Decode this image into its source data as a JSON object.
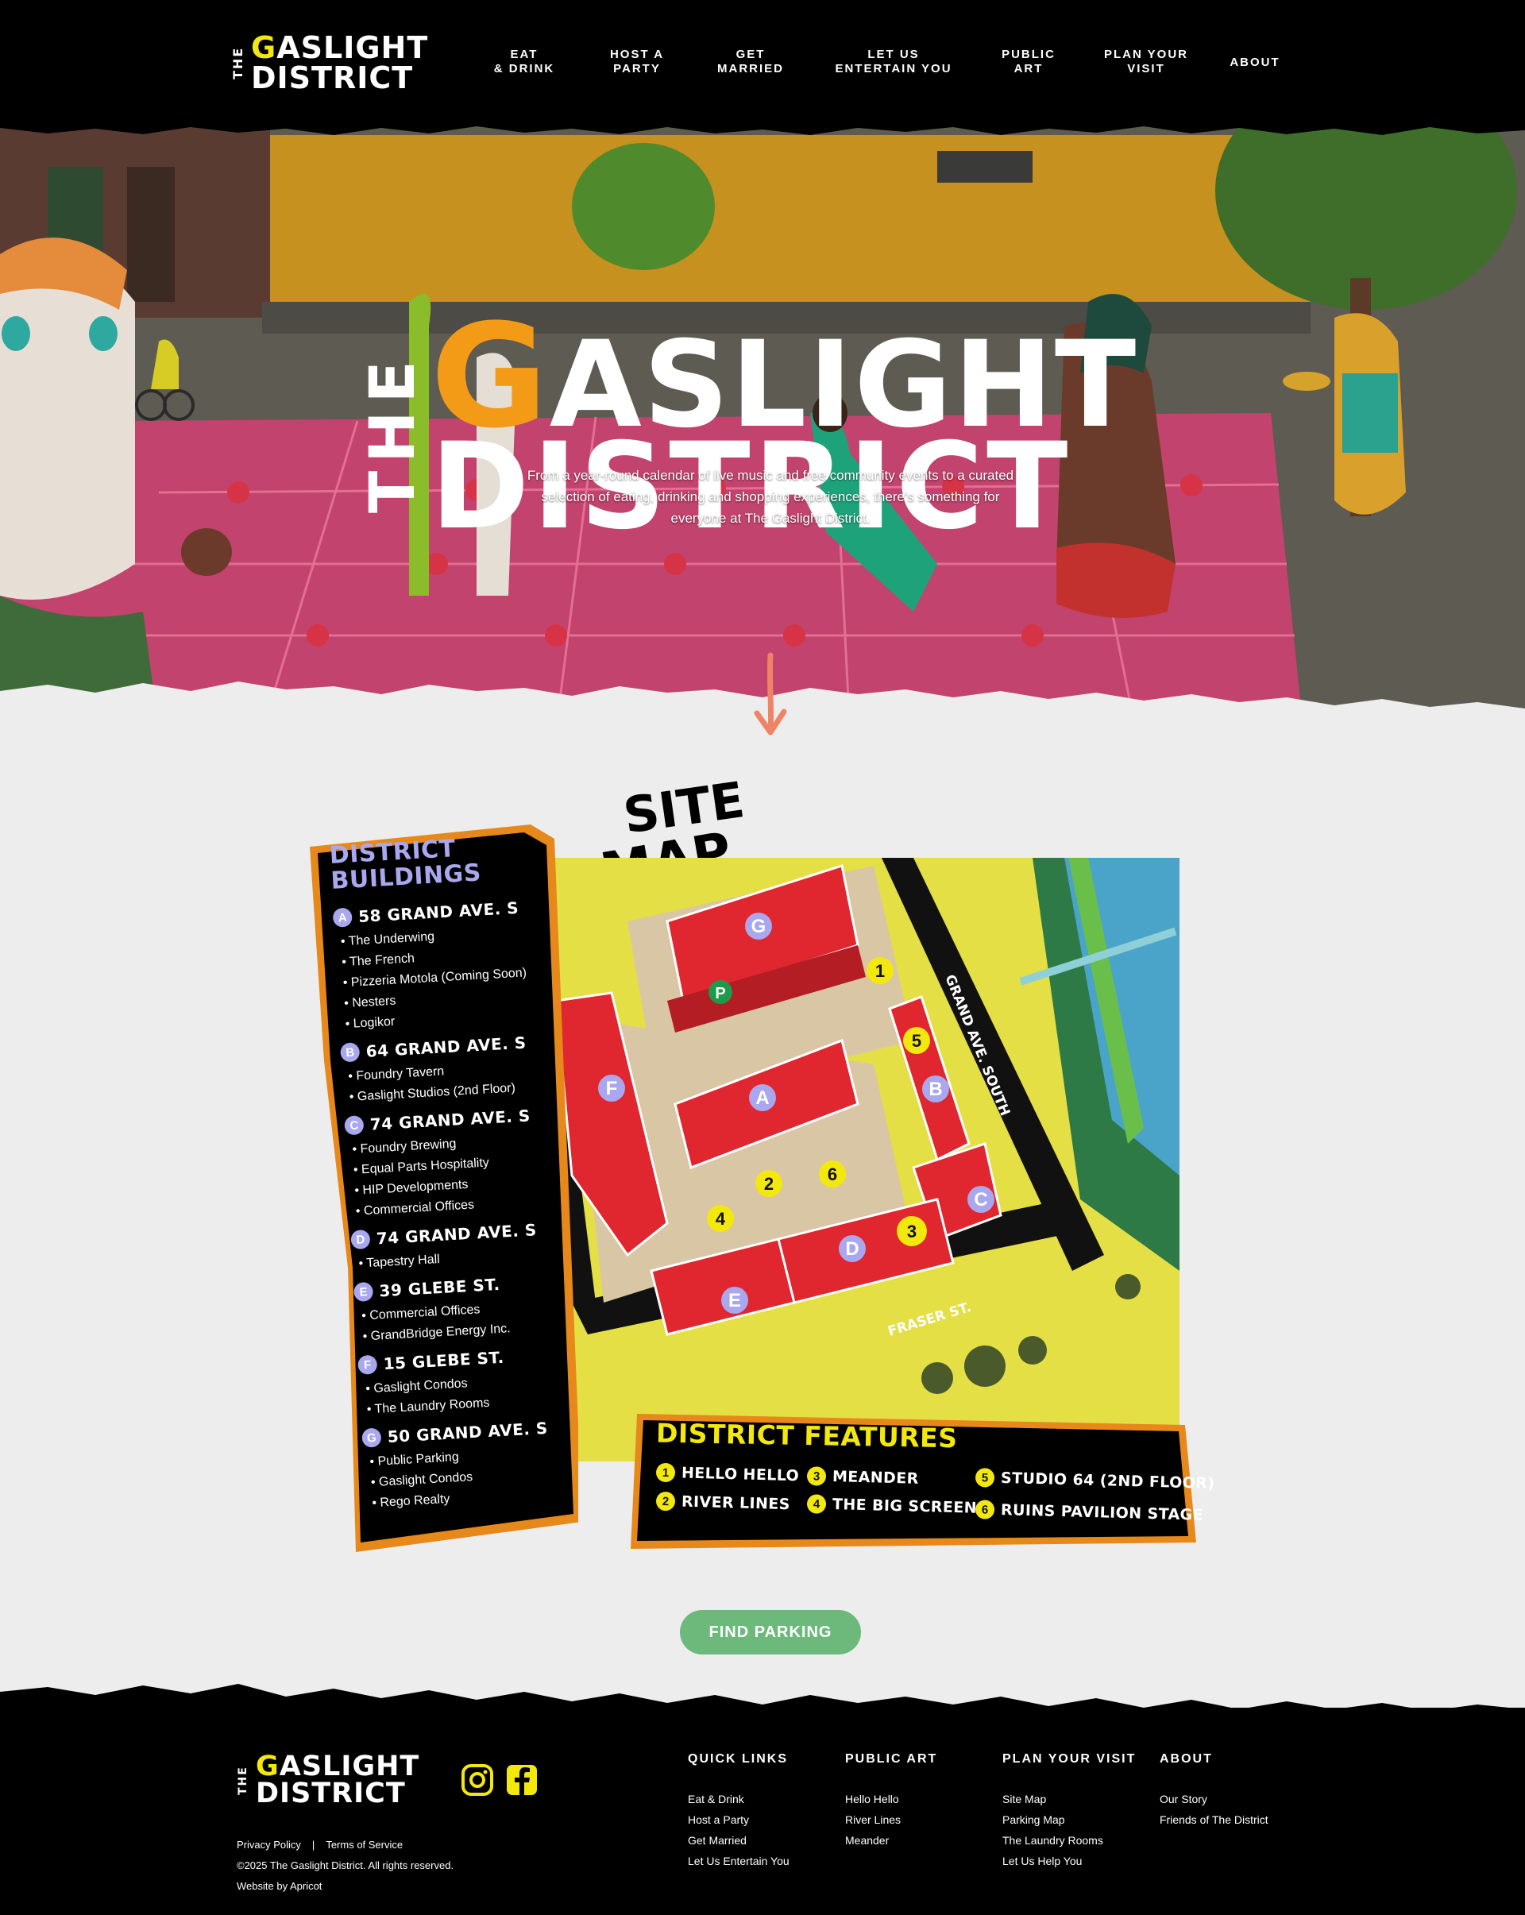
{
  "brand": {
    "the": "THE",
    "gaslight_g": "G",
    "gaslight_rest": "ASLIGHT",
    "district": "DISTRICT"
  },
  "nav": [
    {
      "label": "Eat\n& Drink"
    },
    {
      "label": "Host a\nParty"
    },
    {
      "label": "Get\nMarried"
    },
    {
      "label": "Let Us\nEntertain You"
    },
    {
      "label": "Public\nArt"
    },
    {
      "label": "Plan Your\nVisit"
    },
    {
      "label": "About"
    }
  ],
  "hero": {
    "text": "From a year-round calendar of live music and free community events to a curated selection of eating, drinking and shopping experiences, there's something for everyone at The Gaslight District."
  },
  "sitemap": {
    "heading_line1": "SITE",
    "heading_line2": "MAP",
    "map_labels": {
      "street_grand": "GRAND AVE. SOUTH",
      "street_fraser": "FRASER ST.",
      "parking": "P"
    },
    "buildings_title": "DISTRICT\nBUILDINGS",
    "buildings": [
      {
        "letter": "A",
        "address": "58 GRAND AVE. S",
        "tenants": [
          "The Underwing",
          "The French",
          "Pizzeria Motola (Coming Soon)",
          "Nesters",
          "Logikor"
        ]
      },
      {
        "letter": "B",
        "address": "64 GRAND AVE. S",
        "tenants": [
          "Foundry Tavern",
          "Gaslight Studios (2nd Floor)"
        ]
      },
      {
        "letter": "C",
        "address": "74 GRAND AVE. S",
        "tenants": [
          "Foundry Brewing",
          "Equal Parts Hospitality",
          "HIP Developments",
          "Commercial Offices"
        ]
      },
      {
        "letter": "D",
        "address": "74 GRAND AVE. S",
        "tenants": [
          "Tapestry Hall"
        ]
      },
      {
        "letter": "E",
        "address": "39 GLEBE ST.",
        "tenants": [
          "Commercial Offices",
          "GrandBridge Energy Inc."
        ]
      },
      {
        "letter": "F",
        "address": "15 GLEBE ST.",
        "tenants": [
          "Gaslight Condos",
          "The Laundry Rooms"
        ]
      },
      {
        "letter": "G",
        "address": "50 GRAND AVE. S",
        "tenants": [
          "Public Parking",
          "Gaslight Condos",
          "Rego Realty"
        ]
      }
    ],
    "features_title": "DISTRICT FEATURES",
    "features": [
      {
        "num": "1",
        "name": "HELLO HELLO"
      },
      {
        "num": "2",
        "name": "RIVER LINES"
      },
      {
        "num": "3",
        "name": "MEANDER"
      },
      {
        "num": "4",
        "name": "THE BIG SCREEN"
      },
      {
        "num": "5",
        "name": "STUDIO 64 (2ND FLOOR)"
      },
      {
        "num": "6",
        "name": "RUINS PAVILION STAGE"
      }
    ]
  },
  "cta": {
    "label": "Find Parking"
  },
  "footer": {
    "social": [
      "instagram-icon",
      "facebook-icon"
    ],
    "privacy": "Privacy Policy",
    "separator": "|",
    "terms": "Terms of Service",
    "copyright": "©2025 The Gaslight District. All rights reserved.",
    "credit": "Website by Apricot",
    "columns": [
      {
        "title": "Quick Links",
        "links": [
          "Eat & Drink",
          "Host a Party",
          "Get Married",
          "Let Us Entertain You"
        ]
      },
      {
        "title": "Public Art",
        "links": [
          "Hello Hello",
          "River Lines",
          "Meander"
        ]
      },
      {
        "title": "Plan Your Visit",
        "links": [
          "Site Map",
          "Parking Map",
          "The Laundry Rooms",
          "Let Us Help You"
        ]
      },
      {
        "title": "About",
        "links": [
          "Our Story",
          "Friends of The District"
        ]
      }
    ]
  },
  "colors": {
    "brand_yellow": "#f3e80e",
    "brand_orange": "#f39a17",
    "building_red": "#e0262e",
    "cta_green": "#6cb97b",
    "badge_lavender": "#a9a7ee"
  }
}
